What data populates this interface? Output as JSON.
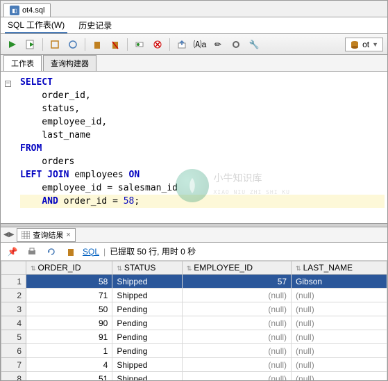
{
  "file_tab": {
    "name": "ot4.sql"
  },
  "worksheet_tabs": {
    "sql": "SQL 工作表(W)",
    "history": "历史记录"
  },
  "connection": {
    "name": "ot"
  },
  "view_tabs": {
    "worksheet": "工作表",
    "builder": "查询构建器"
  },
  "sql": {
    "lines": [
      {
        "t": "SELECT",
        "kw": true
      },
      {
        "t": "    order_id,"
      },
      {
        "t": "    status,"
      },
      {
        "t": "    employee_id,"
      },
      {
        "t": "    last_name"
      },
      {
        "t": "FROM",
        "kw": true
      },
      {
        "t": "    orders"
      },
      {
        "html": "<span class='kw'>LEFT JOIN</span> employees <span class='kw'>ON</span>"
      },
      {
        "t": "    employee_id = salesman_id"
      },
      {
        "html": "    <span class='kw'>AND</span> order_id = <span class='num'>58</span>;",
        "hl": true
      }
    ]
  },
  "results_tab": {
    "label": "查询结果"
  },
  "results_toolbar": {
    "sql_link": "SQL",
    "status": "已提取 50 行, 用时 0 秒"
  },
  "columns": [
    "ORDER_ID",
    "STATUS",
    "EMPLOYEE_ID",
    "LAST_NAME"
  ],
  "rows": [
    {
      "n": 1,
      "order_id": 58,
      "status": "Shipped",
      "employee_id": 57,
      "last_name": "Gibson",
      "selected": true
    },
    {
      "n": 2,
      "order_id": 71,
      "status": "Shipped",
      "employee_id": null,
      "last_name": null
    },
    {
      "n": 3,
      "order_id": 50,
      "status": "Pending",
      "employee_id": null,
      "last_name": null
    },
    {
      "n": 4,
      "order_id": 90,
      "status": "Pending",
      "employee_id": null,
      "last_name": null
    },
    {
      "n": 5,
      "order_id": 91,
      "status": "Pending",
      "employee_id": null,
      "last_name": null
    },
    {
      "n": 6,
      "order_id": 1,
      "status": "Pending",
      "employee_id": null,
      "last_name": null
    },
    {
      "n": 7,
      "order_id": 4,
      "status": "Shipped",
      "employee_id": null,
      "last_name": null
    },
    {
      "n": 8,
      "order_id": 51,
      "status": "Shipped",
      "employee_id": null,
      "last_name": null
    }
  ],
  "watermark": {
    "main": "小牛知识库",
    "sub": "XIAO NIU ZHI SHI KU"
  }
}
